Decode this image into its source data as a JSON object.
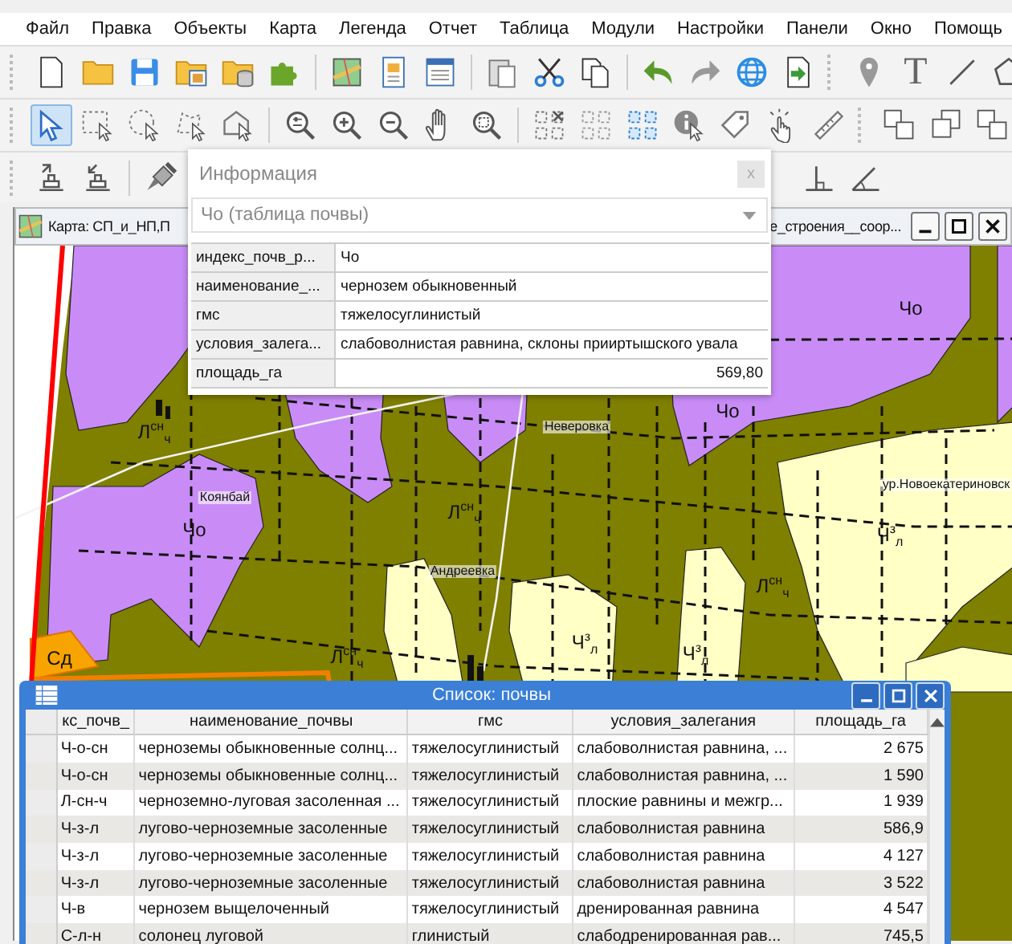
{
  "menu": [
    "Файл",
    "Правка",
    "Объекты",
    "Карта",
    "Легенда",
    "Отчет",
    "Таблица",
    "Модули",
    "Настройки",
    "Панели",
    "Окно",
    "Помощь"
  ],
  "toolbar_1": {
    "text_tool": "T"
  },
  "toolbar_2": {
    "selection_tools": [
      {
        "selected": true
      },
      {
        "selected": false
      },
      {
        "selected": false
      },
      {
        "selected": false
      },
      {
        "selected": false
      }
    ]
  },
  "map_window": {
    "title_left": "Карта: СП_и_НП,П",
    "title_right": "е_строения__соор...",
    "labels": [
      {
        "kind": "soil",
        "text": "Чо"
      },
      {
        "kind": "soil",
        "text": "Чо"
      },
      {
        "kind": "soil",
        "text": "Л$^{сн}$$_{ч}$"
      },
      {
        "kind": "place",
        "text": "Коянбай"
      },
      {
        "kind": "place",
        "text": "Неверовка"
      },
      {
        "kind": "soil",
        "text": "Чо"
      },
      {
        "kind": "soil",
        "text": "Л$^{сн}$$_{ч}$"
      },
      {
        "kind": "place",
        "text": "ур.Новоекатериновск"
      },
      {
        "kind": "soil",
        "text": "Ч$^{з}$$_{л}$"
      },
      {
        "kind": "soil",
        "text": "Л$^{сн}$$_{ч}$"
      },
      {
        "kind": "place",
        "text": "Андреевка"
      },
      {
        "kind": "soil",
        "text": "Сд"
      },
      {
        "kind": "soil",
        "text": "Л$^{сн}$$_{ч}$"
      },
      {
        "kind": "soil",
        "text": "Ч$^{з}$$_{л}$"
      },
      {
        "kind": "soil",
        "text": "Ч$^{з}$$_{л}$"
      }
    ]
  },
  "info_window": {
    "title": "Информация",
    "close": "x",
    "dropdown": "Чо (таблица почвы)",
    "fields": [
      {
        "name": "индекс_почв_р...",
        "value": "Чо",
        "kind": "text"
      },
      {
        "name": "наименование_...",
        "value": "чернозем обыкновенный",
        "kind": "text"
      },
      {
        "name": "гмс",
        "value": "тяжелосуглинистый",
        "kind": "text"
      },
      {
        "name": "условия_залега...",
        "value": "слабоволнистая равнина, склоны прииртышского увала",
        "kind": "text"
      },
      {
        "name": "площадь_га",
        "value": "569,80",
        "kind": "number"
      }
    ]
  },
  "list_window": {
    "title": "Список: почвы",
    "columns": [
      {
        "label": "кс_почв_",
        "kind": "text"
      },
      {
        "label": "наименование_почвы",
        "kind": "text"
      },
      {
        "label": "гмс",
        "kind": "text"
      },
      {
        "label": "условия_залегания",
        "kind": "text"
      },
      {
        "label": "площадь_га",
        "kind": "number"
      }
    ],
    "rows": [
      [
        "Ч-о-сн",
        "черноземы обыкновенные солнц...",
        "тяжелосуглинистый",
        "слабоволнистая равнина, ...",
        "2 675"
      ],
      [
        "Ч-о-сн",
        "черноземы обыкновенные солнц...",
        "тяжелосуглинистый",
        "слабоволнистая равнина, ...",
        "1 590"
      ],
      [
        "Л-сн-ч",
        "черноземно-луговая засоленная ...",
        "тяжелосуглинистый",
        "плоские равнины и межгр...",
        "1 939"
      ],
      [
        "Ч-з-л",
        "лугово-черноземные засоленные",
        "тяжелосуглинистый",
        "слабоволнистая равнина",
        "586,9"
      ],
      [
        "Ч-з-л",
        "лугово-черноземные засоленные",
        "тяжелосуглинистый",
        "слабоволнистая равнина",
        "4 127"
      ],
      [
        "Ч-з-л",
        "лугово-черноземные засоленные",
        "тяжелосуглинистый",
        "слабоволнистая равнина",
        "3 522"
      ],
      [
        "Ч-в",
        "чернозем выщелоченный",
        "тяжелосуглинистый",
        "дренированная равнина",
        "4 547"
      ],
      [
        "С-л-н",
        "солонец луговой",
        "глинистый",
        "слабодренированная рав...",
        "745,5"
      ]
    ]
  }
}
